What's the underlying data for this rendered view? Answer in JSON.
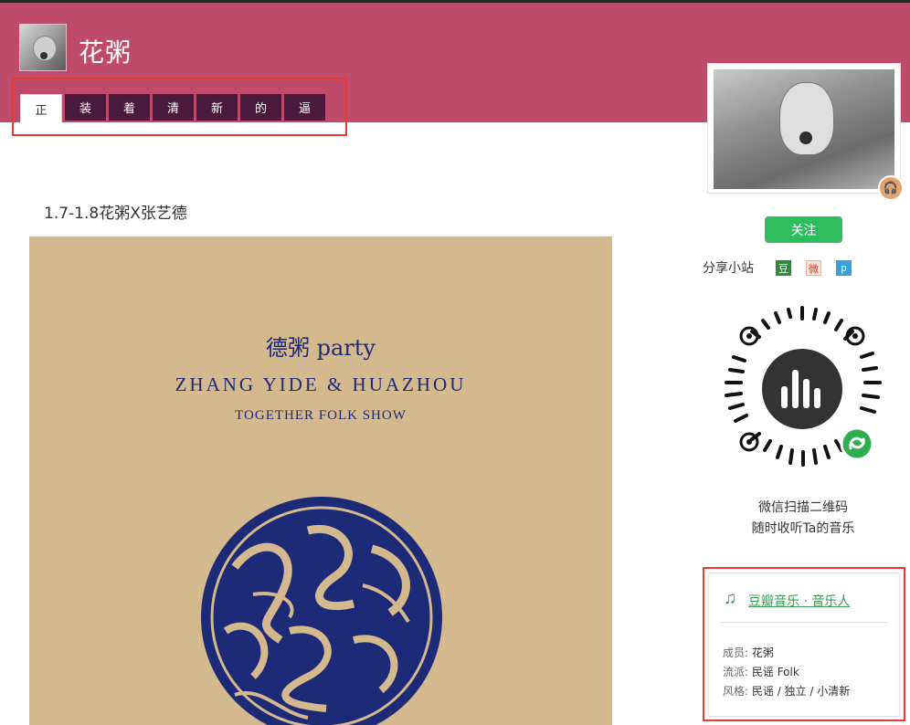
{
  "site": {
    "title": "花粥"
  },
  "tabs": [
    "正",
    "装",
    "着",
    "清",
    "新",
    "的",
    "逼"
  ],
  "post": {
    "title": "1.7-1.8花粥X张艺德"
  },
  "poster": {
    "line1": "德粥 party",
    "line2": "ZHANG YIDE & HUAZHOU",
    "line3": "TOGETHER FOLK SHOW"
  },
  "sidebar": {
    "follow_label": "关注",
    "share_label": "分享小站",
    "share_icons": [
      {
        "name": "douban-share-icon",
        "glyph": "豆",
        "bg": "#2f8b3a",
        "color": "#ffffff"
      },
      {
        "name": "weibo-share-icon",
        "glyph": "微",
        "bg": "#f3e3d8",
        "color": "#d43a2a"
      },
      {
        "name": "pengyou-share-icon",
        "glyph": "p",
        "bg": "#3aa0dc",
        "color": "#ffffff"
      }
    ],
    "qr_caption_1": "微信扫描二维码",
    "qr_caption_2": "随时收听Ta的音乐",
    "musician": {
      "link": "豆瓣音乐 · 音乐人",
      "rows": [
        {
          "key": "成员:",
          "value": "花粥"
        },
        {
          "key": "流派:",
          "value": "民谣 Folk"
        },
        {
          "key": "风格:",
          "value": "民谣 / 独立 / 小清新"
        }
      ]
    }
  },
  "colors": {
    "header": "#c04a6b",
    "tab": "#4b1a3c",
    "follow": "#2fbe5d",
    "highlight": "#e8382f",
    "poster_ink": "#1d2a78"
  }
}
